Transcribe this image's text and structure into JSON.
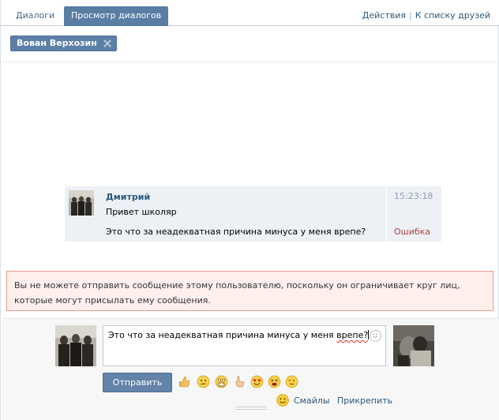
{
  "tabs": [
    {
      "label": "Диалоги",
      "active": false
    },
    {
      "label": "Просмотр диалогов",
      "active": true
    }
  ],
  "top_links": {
    "actions": "Действия",
    "separator": "|",
    "friends": "К списку друзей"
  },
  "recipient_chip": {
    "name": "Вован Верхозин"
  },
  "message": {
    "author": "Дмитрий",
    "lines": [
      "Привет школяр",
      "Это что за неадекватная причина минуса у меня врепе?"
    ],
    "time": "15:23:18",
    "status": "Ошибка"
  },
  "warning": {
    "text": "Вы не можете отправить сообщение этому пользователю, поскольку он ограничивает круг лиц, которые могут присылать ему сообщения."
  },
  "composer": {
    "text_before": "Это что за неадекватная причина минуса у меня ",
    "text_misspelled": "врепе?",
    "send_label": "Отправить",
    "emoji_icons": [
      "thumbs-up-icon",
      "neutral-face-icon",
      "shocked-face-icon",
      "pointing-hand-icon",
      "heart-eyes-face-icon",
      "tired-face-icon",
      "calm-face-icon"
    ],
    "smiles_label": "Смайлы",
    "attach_label": "Прикрепить"
  },
  "colors": {
    "accent": "#597da3",
    "link": "#2b587a",
    "error": "#b04040",
    "warning_bg": "#fff0ee",
    "warning_border": "#e89b88"
  }
}
